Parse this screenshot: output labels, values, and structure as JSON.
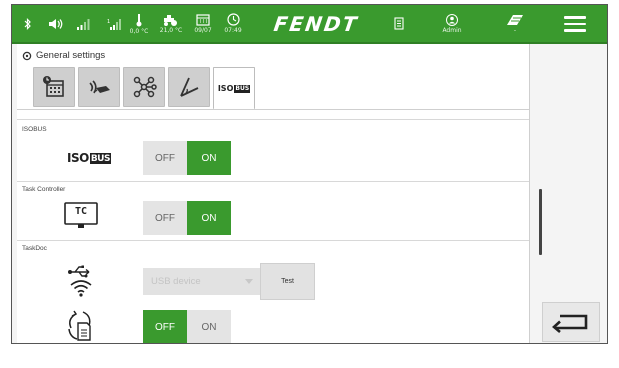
{
  "statusbar": {
    "items": [
      {
        "icon": "bluetooth-icon",
        "label": ""
      },
      {
        "icon": "speaker-icon",
        "label": ""
      },
      {
        "icon": "signal-bars-icon",
        "label": ""
      },
      {
        "icon": "signal-bars-sim-icon",
        "label": ""
      },
      {
        "icon": "thermometer-icon",
        "label": "0,0 °C"
      },
      {
        "icon": "tractor-temperature-icon",
        "label": "21,0 °C"
      },
      {
        "icon": "calendar-icon",
        "label": "09/07"
      },
      {
        "icon": "clock-icon",
        "label": "07:49"
      }
    ],
    "brand": "FENDT",
    "user_label": "Admin",
    "field_label": "-"
  },
  "page": {
    "header_title": "General settings",
    "tabs": [
      {
        "name": "calendar-settings-icon",
        "active": false
      },
      {
        "name": "signal-hand-icon",
        "active": false
      },
      {
        "name": "network-nodes-icon",
        "active": false
      },
      {
        "name": "angle-icon",
        "active": false
      },
      {
        "name": "isobus-tab-icon",
        "active": true,
        "label": "ISO BUS"
      }
    ]
  },
  "sections": {
    "isobus": {
      "title": "ISOBUS",
      "logo_iso": "ISO",
      "logo_bus": "BUS",
      "off_label": "OFF",
      "on_label": "ON",
      "state": "on"
    },
    "task_controller": {
      "title": "Task Controller",
      "icon_text": "TC",
      "off_label": "OFF",
      "on_label": "ON",
      "state": "on"
    },
    "taskdoc": {
      "title": "TaskDoc",
      "select_value": "USB device",
      "test_label": "Test",
      "off_label": "OFF",
      "on_label": "ON",
      "state": "off"
    }
  },
  "colors": {
    "accent": "#3a9a2e",
    "topbar": "#3a9a2e"
  }
}
